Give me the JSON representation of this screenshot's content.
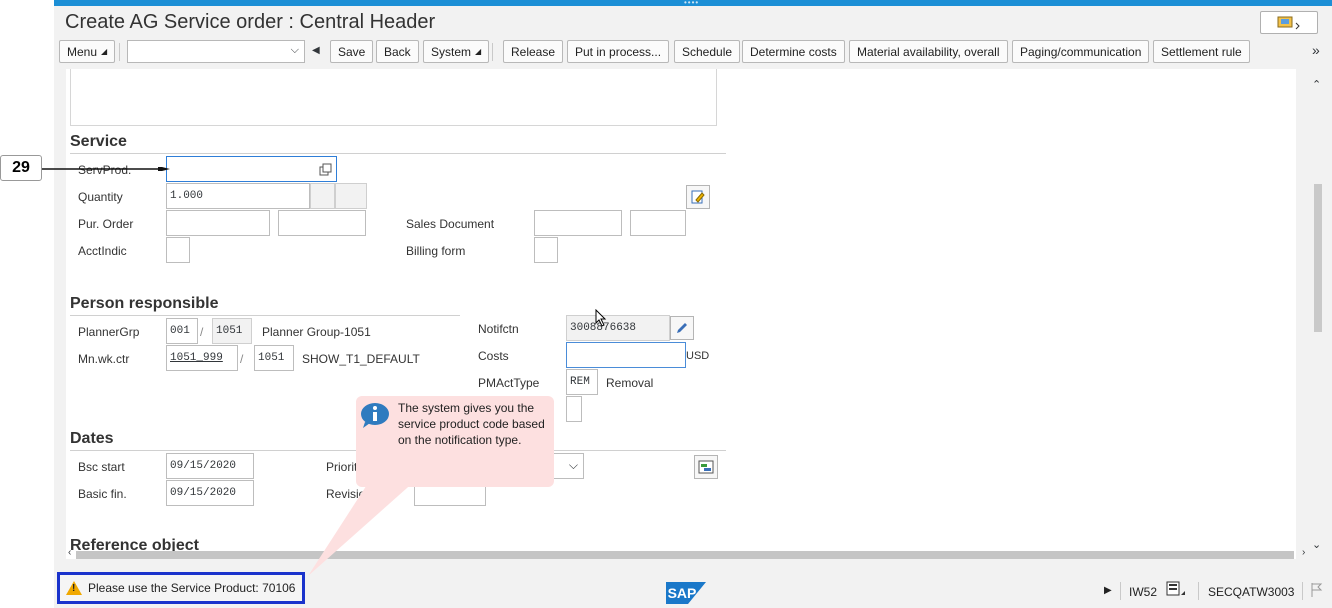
{
  "window": {
    "title": "Create AG Service order : Central Header"
  },
  "toolbar": {
    "menu": "Menu",
    "command_value": "",
    "buttons": [
      "Save",
      "Back",
      "System",
      "Release",
      "Put in process...",
      "Schedule",
      "Determine costs",
      "Material availability, overall",
      "Paging/communication",
      "Settlement rule"
    ],
    "more": "»"
  },
  "service": {
    "title": "Service",
    "servprod_label": "ServProd.",
    "servprod_value": "",
    "quantity_label": "Quantity",
    "quantity_value": "1.000",
    "pur_order_label": "Pur. Order",
    "acctindic_label": "AcctIndic",
    "sales_doc_label": "Sales Document",
    "billing_form_label": "Billing form"
  },
  "person": {
    "title": "Person responsible",
    "plannergrp_label": "PlannerGrp",
    "plannergrp_value": "001",
    "plant_value": "1051",
    "plannergrp_desc": "Planner Group-1051",
    "mnwkctr_label": "Mn.wk.ctr",
    "mnwkctr_value": "1051_999",
    "mnwkctr_plant": "1051",
    "mnwkctr_desc": "SHOW_T1_DEFAULT",
    "notif_label": "Notifctn",
    "notif_value": "3008876638",
    "costs_label": "Costs",
    "costs_value": "",
    "currency": "USD",
    "pmacttype_label": "PMActType",
    "pmacttype_value": "REM",
    "pmacttype_desc": "Removal"
  },
  "dates": {
    "title": "Dates",
    "bsc_start_label": "Bsc start",
    "bsc_start_value": "09/15/2020",
    "basic_fin_label": "Basic fin.",
    "basic_fin_value": "09/15/2020",
    "priority_label": "Priorit",
    "revision_label": "Revision"
  },
  "reference": {
    "title": "Reference object"
  },
  "callout": {
    "text": "The system gives you the service product code based on the notification type."
  },
  "annotation": {
    "step": "29"
  },
  "status": {
    "message": "Please use the Service Product: 70106",
    "transaction": "IW52",
    "system": "SECQATW3003",
    "logo": "SAP"
  }
}
